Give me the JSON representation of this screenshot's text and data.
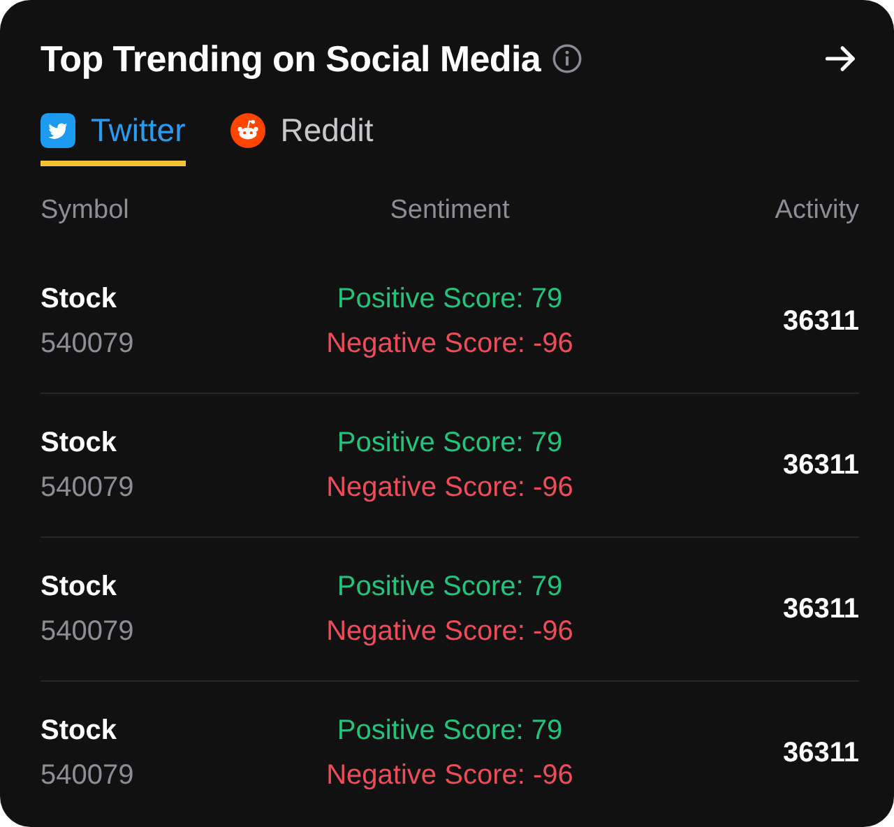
{
  "title": "Top Trending on Social Media",
  "tabs": [
    {
      "label": "Twitter",
      "kind": "twitter",
      "selected": true
    },
    {
      "label": "Reddit",
      "kind": "reddit",
      "selected": false
    }
  ],
  "table": {
    "columns": [
      "Symbol",
      "Sentiment",
      "Activity"
    ],
    "rows": [
      {
        "symbol": "Stock",
        "code": "540079",
        "positive": "Positive Score: 79",
        "negative": "Negative Score: -96",
        "activity": "36311"
      },
      {
        "symbol": "Stock",
        "code": "540079",
        "positive": "Positive Score: 79",
        "negative": "Negative Score: -96",
        "activity": "36311"
      },
      {
        "symbol": "Stock",
        "code": "540079",
        "positive": "Positive Score: 79",
        "negative": "Negative Score: -96",
        "activity": "36311"
      },
      {
        "symbol": "Stock",
        "code": "540079",
        "positive": "Positive Score: 79",
        "negative": "Negative Score: -96",
        "activity": "36311"
      }
    ]
  }
}
